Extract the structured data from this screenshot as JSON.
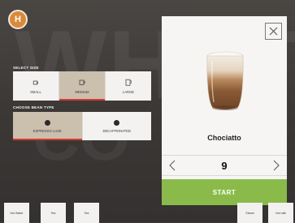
{
  "logo": {
    "letter": "H"
  },
  "background": {
    "word": "WHAT",
    "word2": "CO"
  },
  "size": {
    "title": "SELECT SIZE",
    "options": [
      {
        "label": "SMALL",
        "icon": "small-cup-icon"
      },
      {
        "label": "MEDIUM",
        "icon": "medium-cup-icon",
        "selected": true
      },
      {
        "label": "LARGE",
        "icon": "large-cup-icon"
      }
    ]
  },
  "bean": {
    "title": "CHOOSE BEAN TYPE",
    "options": [
      {
        "label": "ESPRESSO LUXE",
        "selected": true
      },
      {
        "label": "DECAFFEINATED"
      }
    ]
  },
  "product": {
    "name": "Chociatto",
    "quantity": "9",
    "start_label": "START"
  },
  "bottom_buttons": [
    "Hot Water",
    "Tea",
    "Tea",
    "Steam",
    "Hot milk"
  ],
  "colors": {
    "accent_red": "#d63a2e",
    "start_green": "#8abb4a",
    "logo_orange": "#d98a3a"
  }
}
